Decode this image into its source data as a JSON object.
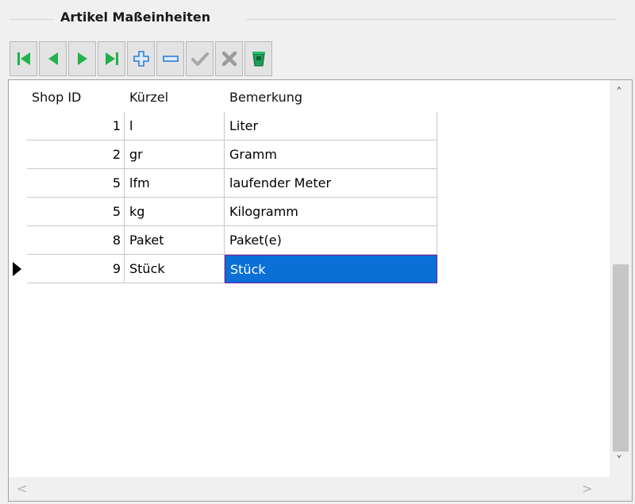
{
  "groupbox": {
    "title": "Artikel Maßeinheiten"
  },
  "toolbar": {
    "buttons": [
      {
        "name": "first-record-button",
        "icon": "first-record-icon",
        "color": "#22b14c"
      },
      {
        "name": "prev-record-button",
        "icon": "prev-record-icon",
        "color": "#22b14c"
      },
      {
        "name": "next-record-button",
        "icon": "next-record-icon",
        "color": "#22b14c"
      },
      {
        "name": "last-record-button",
        "icon": "last-record-icon",
        "color": "#22b14c"
      },
      {
        "name": "add-record-button",
        "icon": "plus-icon",
        "color": "#2f7fd6"
      },
      {
        "name": "delete-record-button",
        "icon": "minus-icon",
        "color": "#2f7fd6"
      },
      {
        "name": "post-edit-button",
        "icon": "check-icon",
        "color": "#a0a0a0"
      },
      {
        "name": "cancel-edit-button",
        "icon": "cancel-x-icon",
        "color": "#a0a0a0"
      },
      {
        "name": "refresh-button",
        "icon": "refresh-bucket-icon",
        "color": "#1f9e5a"
      }
    ]
  },
  "grid": {
    "columns": [
      "Shop ID",
      "Kürzel",
      "Bemerkung"
    ],
    "rows": [
      {
        "shop_id": "1",
        "kuerzel": "l",
        "bemerkung": "Liter"
      },
      {
        "shop_id": "2",
        "kuerzel": "gr",
        "bemerkung": "Gramm"
      },
      {
        "shop_id": "5",
        "kuerzel": "lfm",
        "bemerkung": "laufender Meter"
      },
      {
        "shop_id": "5",
        "kuerzel": "kg",
        "bemerkung": "Kilogramm"
      },
      {
        "shop_id": "8",
        "kuerzel": "Paket",
        "bemerkung": "Paket(e)"
      },
      {
        "shop_id": "9",
        "kuerzel": "Stück",
        "bemerkung": "Stück"
      }
    ],
    "selected_row": 5,
    "selection_color": "#0a6fd6"
  },
  "scroll": {
    "up_glyph": "˄",
    "down_glyph": "˅",
    "left_glyph": "<",
    "right_glyph": ">"
  }
}
